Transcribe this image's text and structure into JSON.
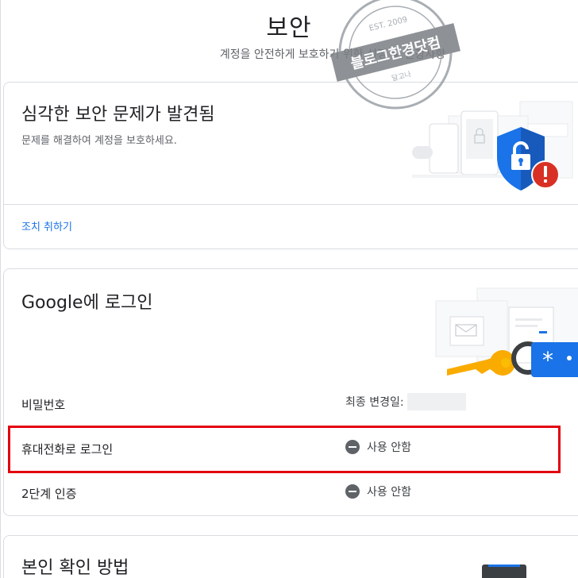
{
  "page": {
    "title": "보안",
    "subtitle": "계정을 안전하게 보호하기 위한 설정 및 권장사항"
  },
  "issue_card": {
    "title": "심각한 보안 문제가 발견됨",
    "description": "문제를 해결하여 계정을 보호하세요.",
    "action_label": "조치 취하기"
  },
  "signin_card": {
    "title": "Google에 로그인",
    "rows": [
      {
        "label": "비밀번호",
        "value": "최종 변경일:"
      },
      {
        "label": "휴대전화로 로그인",
        "value": "사용 안함"
      },
      {
        "label": "2단계 인증",
        "value": "사용 안함"
      }
    ]
  },
  "verify_card": {
    "title": "본인 확인 방법"
  },
  "watermark": {
    "main_text": "블로그한경닷컴",
    "est_text": "EST. 2009",
    "small_text": "달고나"
  },
  "colors": {
    "accent_link": "#1a73e8",
    "alert_red": "#d93025",
    "shield_blue": "#1a73e8",
    "key_yellow": "#f9ab00",
    "highlight_red": "#e3000f"
  },
  "icons": {
    "status_off": "minus-circle-icon",
    "shield": "shield-lock-icon",
    "alert": "alert-badge-icon",
    "key": "key-icon"
  }
}
